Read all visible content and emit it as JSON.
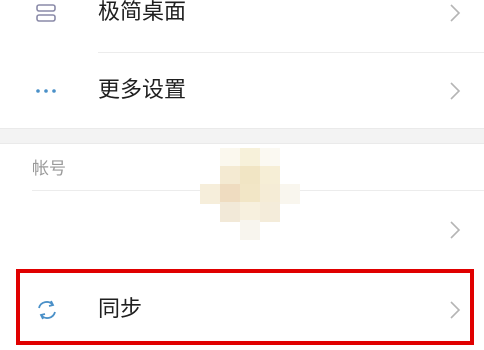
{
  "settings": {
    "items": [
      {
        "label": "极简桌面",
        "icon": "minimal-desktop-icon"
      },
      {
        "label": "更多设置",
        "icon": "more-dots-icon"
      }
    ],
    "account_section": {
      "title": "帐号",
      "sync_label": "同步",
      "sync_icon": "sync-icon"
    }
  },
  "colors": {
    "accent_icon": "#4a90c8",
    "highlight_box": "#e00000",
    "chevron": "#b5b5b5"
  }
}
